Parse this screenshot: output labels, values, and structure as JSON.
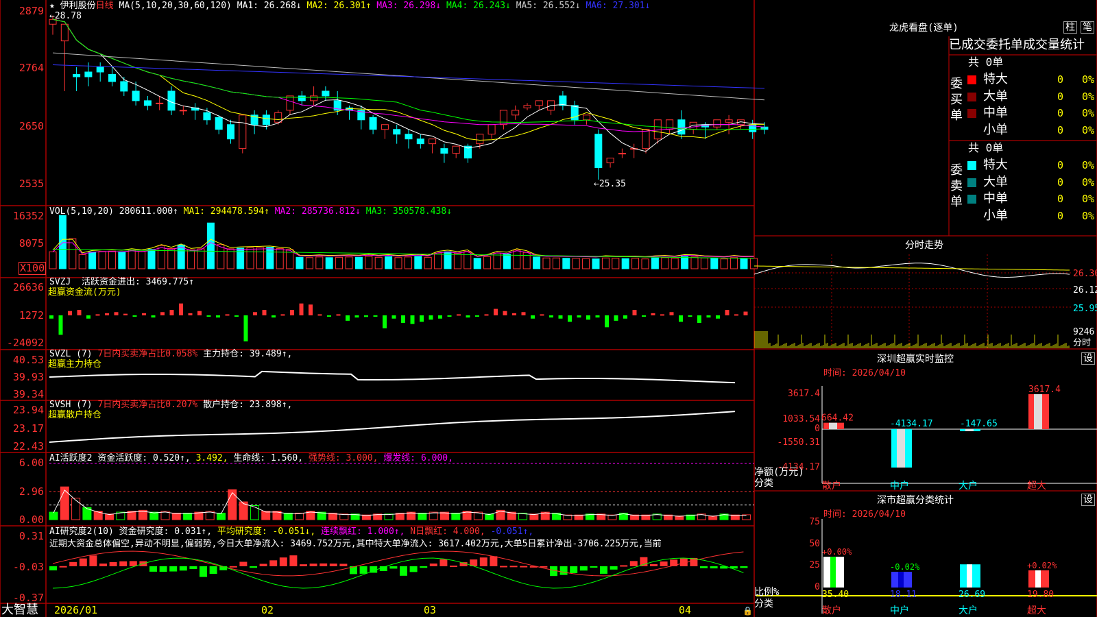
{
  "colors": {
    "up": "#ff3333",
    "down": "#00ffff",
    "down2": "#00ff00",
    "frame": "#aa0000",
    "ma1": "#ffffff",
    "ma2": "#ffff00",
    "ma3": "#ff00ff",
    "ma4": "#00ff00",
    "ma5": "#bbbbbb",
    "ma6": "#3333ff",
    "bg": "#000000"
  },
  "header": {
    "star_icon": "star-icon",
    "stock": "伊利股份",
    "period": "日线",
    "ma_params": "MA(5,10,20,30,60,120)",
    "ma1": "MA1: 26.268↓",
    "ma2": "MA2: 26.301↑",
    "ma3": "MA3: 26.298↓",
    "ma4": "MA4: 26.243↓",
    "ma5": "MA5: 26.552↓",
    "ma6": "MA6: 27.301↓"
  },
  "footer": {
    "brand": "大智慧",
    "date_ticks": [
      "2026/01",
      "02",
      "03",
      "04"
    ],
    "lock_icon": "lock-icon"
  },
  "panels": {
    "price": {
      "ticks": [
        "2879",
        "2764",
        "2650",
        "2535"
      ],
      "max_label": "28.78",
      "min_label": "25.35"
    },
    "vol": {
      "title": "VOL(5,10,20)",
      "val": "280611.000↑",
      "ma1": "MA1: 294478.594↑",
      "ma2": "MA2: 285736.812↓",
      "ma3": "MA3: 350578.438↓",
      "ticks": [
        "16352",
        "8075"
      ],
      "unit": "X100"
    },
    "svzj": {
      "title": "SVZJ",
      "label": "活跃资金进出: 3469.775↑",
      "sub": "超赢资金流(万元)",
      "ticks": [
        "26636",
        "1272",
        "-24092"
      ]
    },
    "svzl": {
      "title": "SVZL (7)",
      "ratio": "7日内买卖净占比0.058%",
      "hold": "主力持仓: 39.489↑,",
      "sub": "超赢主力持仓",
      "ticks": [
        "40.53",
        "39.93",
        "39.34"
      ]
    },
    "svsh": {
      "title": "SVSH (7)",
      "ratio": "7日内买卖净占比0.207%",
      "hold": "散户持仓: 23.898↑,",
      "sub": "超赢散户持仓",
      "ticks": [
        "23.94",
        "23.17",
        "22.43"
      ]
    },
    "ai2": {
      "title": "AI活跃度2",
      "act": "资金活跃度: 0.520↑,",
      "v2": "3.492,",
      "life": "生命线: 1.560,",
      "strong": "强势线: 3.000,",
      "burst": "爆发线: 6.000,",
      "ticks": [
        "6.00",
        "2.96",
        "0.00"
      ]
    },
    "ai_research": {
      "title": "AI研究度2(10)",
      "res": "资金研究度: 0.031↑,",
      "avg": "平均研究度: -0.051↓,",
      "cont": "连续飘红: 1.000↑,",
      "nday": "N日飘红: 4.000,",
      "last": "-0.051↑,",
      "note": "近期大资金总体偏空,异动不明显,偏弱势,今日大单净流入: 3469.752万元,其中特大单净流入: 3617.402万元,大单5日累计净出-3706.225万元,当前",
      "ticks": [
        "0.31",
        "-0.03",
        "-0.37"
      ]
    }
  },
  "right": {
    "lhb": {
      "title": "龙虎看盘(逐单)",
      "btn1": "柱",
      "btn2": "笔",
      "head": "已成交委托单成交量统计",
      "buy": {
        "side": "委买单",
        "count": "共 0单",
        "rows": [
          {
            "name": "特大",
            "n": "0",
            "p": "0%"
          },
          {
            "name": "大单",
            "n": "0",
            "p": "0%"
          },
          {
            "name": "中单",
            "n": "0",
            "p": "0%"
          },
          {
            "name": "小单",
            "n": "0",
            "p": "0%"
          }
        ]
      },
      "sell": {
        "side": "委卖单",
        "count": "共 0单",
        "rows": [
          {
            "name": "特大",
            "n": "0",
            "p": "0%"
          },
          {
            "name": "大单",
            "n": "0",
            "p": "0%"
          },
          {
            "name": "中单",
            "n": "0",
            "p": "0%"
          },
          {
            "name": "小单",
            "n": "0",
            "p": "0%"
          }
        ]
      }
    },
    "intraday": {
      "title": "分时走势",
      "labels": [
        "26.30",
        "26.12",
        "25.95"
      ],
      "vol": "9246",
      "vol_unit": "分时"
    },
    "monitor": {
      "title": "深圳超赢实时监控",
      "btn": "设",
      "time": "时间: 2026/04/10",
      "yticks": [
        "3617.4",
        "1033.54",
        "0",
        "-1550.31",
        "-4134.17"
      ],
      "ylabel": "净额(万元)",
      "xlabel": "分类"
    },
    "classify": {
      "title": "深市超赢分类统计",
      "btn": "设",
      "time": "时间: 2026/04/10",
      "yticks": [
        "75",
        "50",
        "25",
        "0"
      ],
      "ylabel": "比例%",
      "xlabel": "分类"
    }
  },
  "chart_data": [
    {
      "type": "candlestick",
      "title": "伊利股份 日线",
      "ylim": [
        25.35,
        28.79
      ],
      "ma_lines": [
        "MA1",
        "MA2",
        "MA3",
        "MA4",
        "MA5",
        "MA6"
      ],
      "candles": [
        [
          28.6,
          28.78,
          28.7,
          28.38
        ],
        [
          28.25,
          28.4,
          28.6,
          27.2
        ],
        [
          27.55,
          27.7,
          27.5,
          27.2
        ],
        [
          27.6,
          27.8,
          27.5,
          27.3
        ],
        [
          27.7,
          27.8,
          27.6,
          27.4
        ],
        [
          27.55,
          27.7,
          27.4,
          27.3
        ],
        [
          27.4,
          27.5,
          27.2,
          27.1
        ],
        [
          27.2,
          27.4,
          27.0,
          26.9
        ],
        [
          27.0,
          27.1,
          26.9,
          26.8
        ],
        [
          26.95,
          27.1,
          26.95,
          26.8
        ],
        [
          27.2,
          27.3,
          26.8,
          26.7
        ],
        [
          26.8,
          26.9,
          26.8,
          26.7
        ],
        [
          26.85,
          26.95,
          26.8,
          26.6
        ],
        [
          26.75,
          26.85,
          26.6,
          26.5
        ],
        [
          26.65,
          26.7,
          26.4,
          26.3
        ],
        [
          26.5,
          26.6,
          26.2,
          26.1
        ],
        [
          26.0,
          26.2,
          26.7,
          25.9
        ],
        [
          26.7,
          26.8,
          26.5,
          26.3
        ],
        [
          26.7,
          26.8,
          26.5,
          26.4
        ],
        [
          26.55,
          26.8,
          26.75,
          26.5
        ],
        [
          26.8,
          26.9,
          27.1,
          26.7
        ],
        [
          27.1,
          27.2,
          27.0,
          26.9
        ],
        [
          27.0,
          27.3,
          27.1,
          26.9
        ],
        [
          27.2,
          27.3,
          27.1,
          27.0
        ],
        [
          27.0,
          27.2,
          26.8,
          26.7
        ],
        [
          26.85,
          26.9,
          26.8,
          26.6
        ],
        [
          26.8,
          26.9,
          26.6,
          26.4
        ],
        [
          26.65,
          26.7,
          26.4,
          26.3
        ],
        [
          26.4,
          26.5,
          26.5,
          26.2
        ],
        [
          26.4,
          26.5,
          26.3,
          26.1
        ],
        [
          26.3,
          26.4,
          26.2,
          26.0
        ],
        [
          26.2,
          26.3,
          26.1,
          26.0
        ],
        [
          26.1,
          26.2,
          26.2,
          25.9
        ],
        [
          26.0,
          26.1,
          25.9,
          25.7
        ],
        [
          25.9,
          26.0,
          26.05,
          25.8
        ],
        [
          26.05,
          26.1,
          25.8,
          25.7
        ],
        [
          26.1,
          26.3,
          26.3,
          26.0
        ],
        [
          26.3,
          26.5,
          26.5,
          26.2
        ],
        [
          26.5,
          26.6,
          26.8,
          26.4
        ],
        [
          26.7,
          26.9,
          26.8,
          26.6
        ],
        [
          26.85,
          26.95,
          26.9,
          26.8
        ],
        [
          26.9,
          27.0,
          27.0,
          26.8
        ],
        [
          26.8,
          26.9,
          27.0,
          26.7
        ],
        [
          27.1,
          27.2,
          26.9,
          26.8
        ],
        [
          26.9,
          27.0,
          26.6,
          26.5
        ],
        [
          26.6,
          26.7,
          26.7,
          26.5
        ],
        [
          26.3,
          26.4,
          25.6,
          25.35
        ],
        [
          25.7,
          25.8,
          25.8,
          25.6
        ],
        [
          25.9,
          26.0,
          25.9,
          25.8
        ],
        [
          26.0,
          26.1,
          26.0,
          25.8
        ],
        [
          26.0,
          26.3,
          26.4,
          25.9
        ],
        [
          26.2,
          26.4,
          26.6,
          26.1
        ],
        [
          26.4,
          26.6,
          26.6,
          26.3
        ],
        [
          26.6,
          26.8,
          26.3,
          26.2
        ],
        [
          26.4,
          26.55,
          26.55,
          26.3
        ],
        [
          26.5,
          26.55,
          26.45,
          26.2
        ],
        [
          26.45,
          26.6,
          26.6,
          26.4
        ],
        [
          26.55,
          26.7,
          26.6,
          26.3
        ],
        [
          26.5,
          26.6,
          26.6,
          26.4
        ],
        [
          26.5,
          26.6,
          26.35,
          26.2
        ],
        [
          26.45,
          26.55,
          26.4,
          26.3
        ]
      ]
    },
    {
      "type": "bar",
      "title": "VOL(5,10,20)",
      "values": [
        5.2,
        16.3,
        9.2,
        4.3,
        5.1,
        5.3,
        5.4,
        5.2,
        5.7,
        5.3,
        5.9,
        7.1,
        6.2,
        7.3,
        5.8,
        6.1,
        14.0,
        7.4,
        6.1,
        6.3,
        6.4,
        6.5,
        6.6,
        6.2,
        5.9,
        3.5,
        3.4,
        3.6,
        3.4,
        3.5,
        3.6,
        3.5,
        3.8,
        3.5,
        3.7,
        3.4,
        3.6,
        3.8,
        3.5,
        4.8,
        5.2,
        4.7,
        5.3,
        3.2,
        3.7,
        4.8,
        4.5,
        5.7,
        5.0,
        3.6,
        3.3,
        3.3,
        3.2,
        3.2,
        3.1,
        3.0,
        3.3,
        3.2,
        3.1,
        3.2,
        3.0,
        3.3,
        3.4,
        3.2,
        3.7,
        3.6,
        3.3,
        3.2,
        3.0,
        3.4,
        3.1,
        3.2
      ]
    },
    {
      "type": "bar",
      "title": "SVZJ 活跃资金进出",
      "values": [
        -3000,
        -18000,
        4000,
        5000,
        -3000,
        1000,
        2000,
        3000,
        1500,
        -500,
        2000,
        -2000,
        3000,
        5000,
        11000,
        2000,
        4000,
        -1000,
        -2000,
        1000,
        -1000,
        -24092,
        3000,
        5000,
        -2000,
        1000,
        5000,
        11000,
        10000,
        1000,
        -1000,
        1000,
        -5000,
        -2000,
        -1500,
        -1000,
        -12000,
        -3000,
        -7000,
        -8000,
        -6000,
        -4000,
        -3000,
        -1000,
        1000,
        -2000,
        -1000,
        1000,
        6000,
        4000,
        2000,
        3000,
        -3000,
        1000,
        -2000,
        -3000,
        -6000,
        -2000,
        -4000,
        -2000,
        -11000,
        -5000,
        -3000,
        5000,
        -1000,
        2000,
        1000,
        3000,
        -6000,
        -1000,
        -7000,
        -2000,
        -3000,
        5000,
        1000,
        3469.775
      ]
    },
    {
      "type": "bar",
      "title": "AI活跃度2",
      "values": [
        0.8,
        3.5,
        2.3,
        1.3,
        0.9,
        0.6,
        0.8,
        0.9,
        1.0,
        0.8,
        0.9,
        0.7,
        0.7,
        0.8,
        0.9,
        0.7,
        3.2,
        1.9,
        1.5,
        0.9,
        0.9,
        0.7,
        0.7,
        0.9,
        0.8,
        0.7,
        0.6,
        0.6,
        0.5,
        0.6,
        0.6,
        0.7,
        0.8,
        0.7,
        0.8,
        0.8,
        0.7,
        0.9,
        0.8,
        0.6,
        1.0,
        0.8,
        0.7,
        0.6,
        0.8,
        0.7,
        0.5,
        0.5,
        0.6,
        0.6,
        0.5,
        0.7,
        0.5,
        0.5,
        0.6,
        0.5,
        0.4,
        0.5,
        0.6,
        0.4,
        0.6,
        0.5,
        0.52
      ]
    },
    {
      "type": "bar",
      "title": "深圳超赢实时监控",
      "categories": [
        "散户",
        "中户",
        "大户",
        "超大"
      ],
      "values": [
        664.42,
        -4134.17,
        -147.65,
        3617.4
      ],
      "ylim": [
        -4134.17,
        3617.4
      ]
    },
    {
      "type": "bar",
      "title": "深市超赢分类统计",
      "categories": [
        "散户",
        "中户",
        "大户",
        "超大"
      ],
      "values": [
        35.4,
        18.11,
        26.69,
        19.8
      ],
      "changes": [
        "+0.00%",
        "-0.02%",
        "",
        "+0.02%"
      ],
      "ylim": [
        0,
        75
      ]
    }
  ]
}
